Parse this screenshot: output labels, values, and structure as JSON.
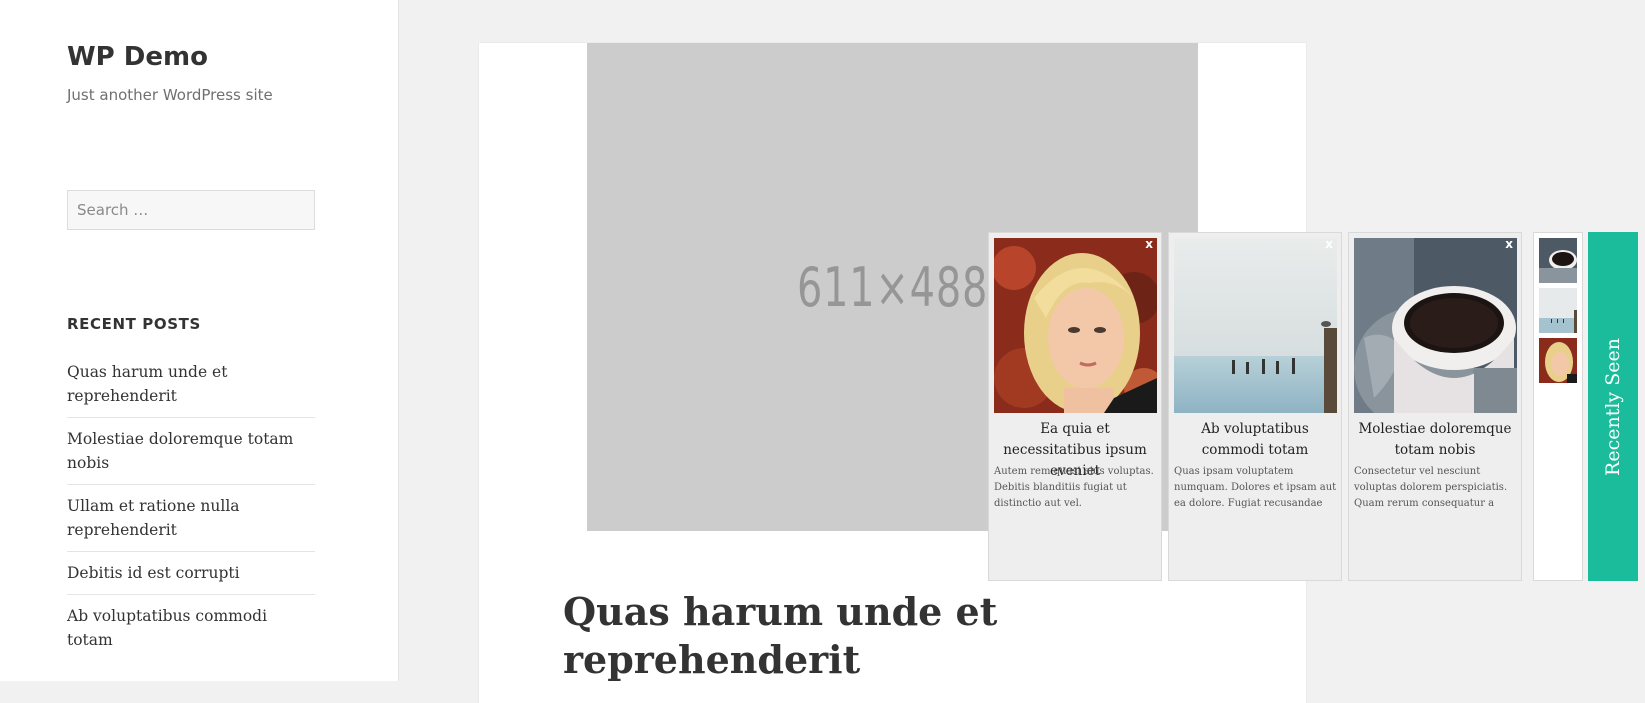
{
  "site": {
    "title": "WP Demo",
    "description": "Just another WordPress site"
  },
  "search": {
    "placeholder": "Search …"
  },
  "recent_posts": {
    "heading": "RECENT POSTS",
    "items": [
      "Quas harum unde et reprehenderit",
      "Molestiae doloremque totam nobis",
      "Ullam et ratione nulla reprehenderit",
      "Debitis id est corrupti",
      "Ab voluptatibus commodi totam"
    ]
  },
  "article": {
    "image_placeholder": "611×488",
    "title": "Quas harum unde et reprehenderit"
  },
  "recently_seen": {
    "tab_label": "Recently Seen",
    "close_label": "x",
    "cards": [
      {
        "title": "Ea quia et necessitatibus ipsum eveniet",
        "excerpt": "Autem rem quasi eius voluptas. Debitis blanditiis fugiat ut distinctio aut vel.",
        "image": "portrait-photo"
      },
      {
        "title": "Ab voluptatibus commodi totam",
        "excerpt": "Quas ipsam voluptatem numquam. Dolores et ipsam aut ea dolore. Fugiat recusandae",
        "image": "sea-photo"
      },
      {
        "title": "Molestiae doloremque totam nobis",
        "excerpt": "Consectetur vel nesciunt voluptas dolorem perspiciatis. Quam rerum consequatur a",
        "image": "coffee-photo"
      }
    ]
  },
  "colors": {
    "accent": "#1abc9c",
    "page_bg": "#f1f1f1",
    "placeholder_bg": "#cccccc"
  }
}
